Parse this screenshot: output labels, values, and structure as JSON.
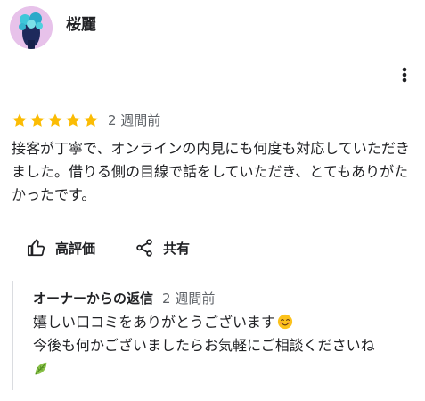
{
  "review": {
    "author": "桜麗",
    "rating": 5,
    "rating_max": 5,
    "date": "2 週間前",
    "text": "接客が丁寧で、オンラインの内見にも何度も対応していただきました。借りる側の目線で話をしていただき、とてもありがたかったです。"
  },
  "actions": {
    "like_label": "高評価",
    "share_label": "共有"
  },
  "owner_reply": {
    "title": "オーナーからの返信",
    "date": "2 週間前",
    "line1": "嬉しい口コミをありがとうございます",
    "line2": "今後も何かございましたらお気軽にご相談くださいね"
  },
  "colors": {
    "star": "#fbbc04",
    "text": "#202124",
    "secondary": "#5f6368",
    "reply_border": "#dadce0",
    "avatar_bg": "#e7c2ea"
  },
  "icons": {
    "more": "more-vert-icon",
    "like": "thumb-up-icon",
    "share": "share-icon",
    "smile": "smiling-face-emoji",
    "leaf": "leaf-emoji"
  }
}
